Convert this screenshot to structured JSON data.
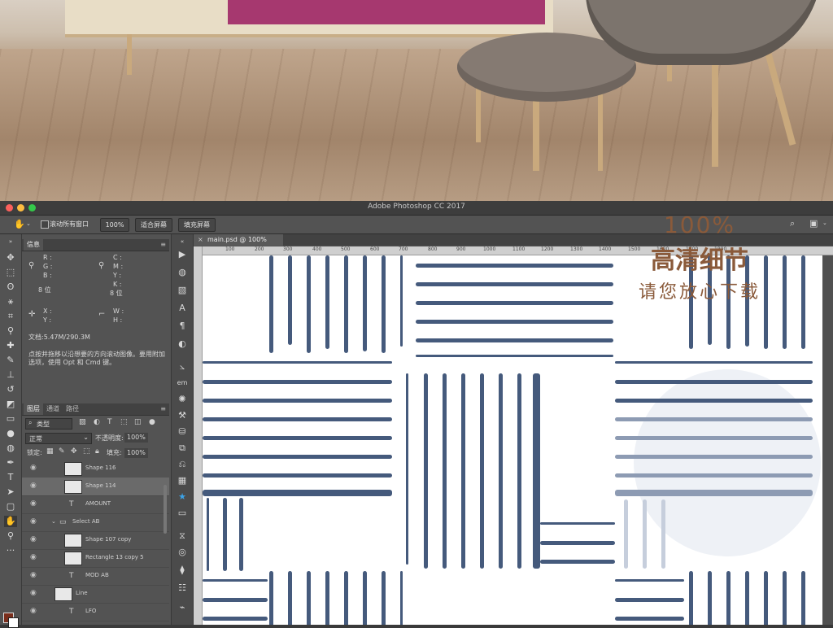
{
  "window": {
    "title": "Adobe Photoshop CC 2017"
  },
  "options_bar": {
    "scroll_all_windows": "滚动所有窗口",
    "zoom": "100%",
    "fit_screen": "适合屏幕",
    "fill_screen": "填充屏幕"
  },
  "info_panel": {
    "tab": "信息",
    "labels": {
      "r": "R :",
      "g": "G :",
      "b": "B :",
      "c": "C :",
      "m": "M :",
      "y": "Y :",
      "k": "K :",
      "x": "X :",
      "y2": "Y :",
      "w": "W :",
      "h": "H :"
    },
    "bit_left": "8 位",
    "bit_right": "8 位",
    "doc_size": "文档:5.47M/290.3M",
    "hint": "点按并拖移以沿想要的方向滚动图像。要用附加选项，使用 Opt 和 Cmd 键。"
  },
  "layers_panel": {
    "tabs": [
      "图层",
      "通道",
      "路径"
    ],
    "filter_kind": "类型",
    "blend_mode": "正常",
    "opacity_label": "不透明度:",
    "opacity_value": "100%",
    "lock_label": "锁定:",
    "fill_label": "填充:",
    "fill_value": "100%",
    "layers": [
      {
        "name": "Shape 116",
        "type": "shape"
      },
      {
        "name": "Shape 114",
        "type": "shape"
      },
      {
        "name": "AMOUNT",
        "type": "text"
      },
      {
        "name": "Select AB",
        "type": "group"
      },
      {
        "name": "Shape 107 copy",
        "type": "shape"
      },
      {
        "name": "Rectangle 13 copy 5",
        "type": "shape"
      },
      {
        "name": "MOD AB",
        "type": "text"
      },
      {
        "name": "Line",
        "type": "shape"
      },
      {
        "name": "LFO",
        "type": "text"
      }
    ]
  },
  "document": {
    "tab_title": "main.psd @ 100%",
    "ruler_ticks": [
      "100",
      "200",
      "300",
      "400",
      "500",
      "600",
      "700",
      "800",
      "900",
      "1000",
      "1100",
      "1200",
      "1300",
      "1400",
      "1500",
      "1600",
      "1700",
      "1800"
    ]
  },
  "promo": {
    "line1": "100%",
    "line2": "高清细节",
    "line3": "请您放心下载"
  },
  "colors": {
    "stripe": "#455a7c",
    "promo_text": "#8a5a3a",
    "panel": "#535353"
  }
}
